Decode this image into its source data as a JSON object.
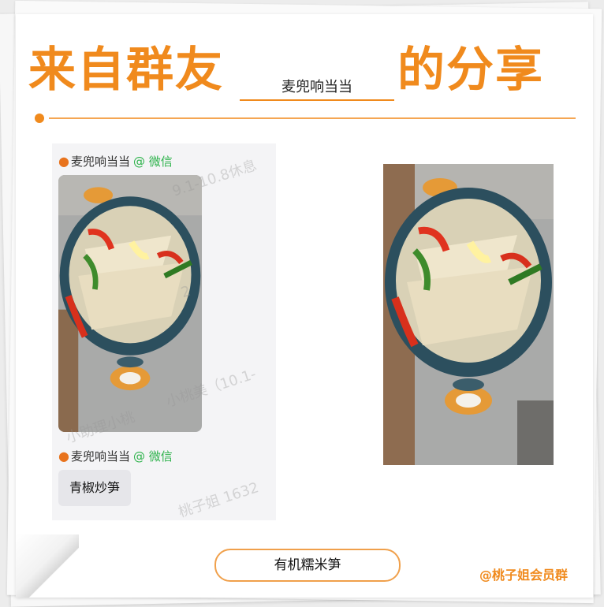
{
  "header": {
    "title_left": "来自群友",
    "member_name": "麦兜响当当",
    "title_right": "的分享"
  },
  "chat": {
    "sender_1": "麦兜响当当",
    "sender_2": "麦兜响当当",
    "via_label": "@ 微信",
    "via_label_2": "@ 微信",
    "message_text": "青椒炒笋",
    "watermarks": [
      "9.1-10.8休息",
      "小助理小桃",
      "小桃美（10.1-",
      "桃子姐 1632",
      "2"
    ]
  },
  "footer": {
    "product_name": "有机糯米笋",
    "group_tag": "@桃子姐会员群"
  },
  "icons": {
    "sender_avatar": "peach-icon"
  },
  "colors": {
    "accent": "#f08a1d",
    "wechat_green": "#2cb24a",
    "pot_blue": "#2c4f5e"
  }
}
